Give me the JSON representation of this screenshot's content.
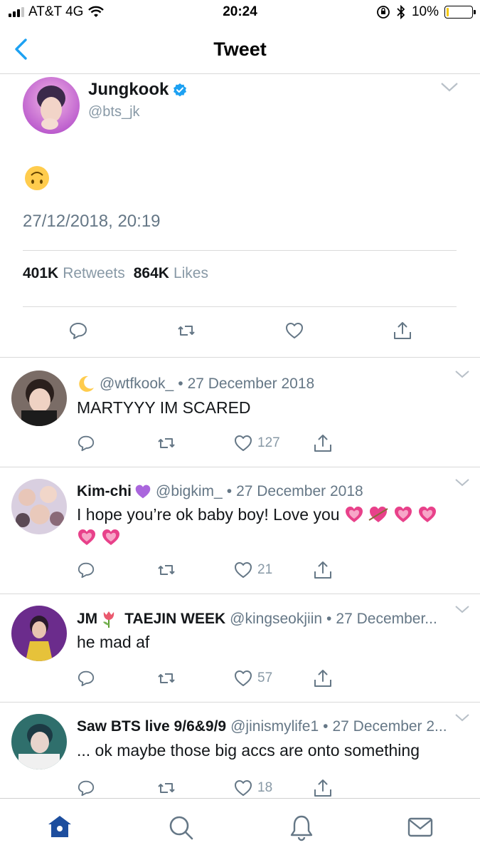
{
  "status_bar": {
    "carrier": "AT&T 4G",
    "time": "20:24",
    "battery": "10%",
    "battery_level": 0.1,
    "icons": [
      "signal-icon",
      "wifi-icon",
      "orientation-lock-icon",
      "bluetooth-icon",
      "battery-icon"
    ]
  },
  "nav": {
    "title": "Tweet",
    "back_icon": "chevron-left-icon"
  },
  "tweet": {
    "name": "Jungkook",
    "handle": "@bts_jk",
    "verified": true,
    "content_emoji": "upside-down-face",
    "date": "27/12/2018, 20:19",
    "retweets_count": "401K",
    "retweets_label": "Retweets",
    "likes_count": "864K",
    "likes_label": "Likes",
    "actions": [
      "reply-icon",
      "retweet-icon",
      "like-icon",
      "share-icon"
    ]
  },
  "replies": [
    {
      "name_emoji": "crescent-moon",
      "name": "",
      "handle": "@wtfkook_",
      "dot": "•",
      "date": "27 December 2018",
      "text": "MARTYYY IM SCARED",
      "likes": "127"
    },
    {
      "name": "Kim-chi",
      "name_emoji": "purple-heart",
      "handle": "@bigkim_",
      "dot": "•",
      "date": "27 December 2018",
      "text": "I hope you’re ok baby boy! Love you",
      "text_emojis": [
        "growing-heart",
        "heart-with-arrow",
        "growing-heart",
        "growing-heart",
        "growing-heart",
        "growing-heart"
      ],
      "likes": "21"
    },
    {
      "name": "JM",
      "name_emoji": "tulip",
      "name_suffix": "TAEJIN WEEK",
      "handle": "@kingseokjiin",
      "dot": "•",
      "date": "27 December...",
      "text": "he mad af",
      "likes": "57"
    },
    {
      "name": "Saw BTS live 9/6&9/9",
      "handle": "@jinismylife1",
      "dot": "•",
      "date": "27 December 2...",
      "text": "... ok maybe those big accs are onto something",
      "likes": "18"
    }
  ],
  "tab_bar": {
    "tabs": [
      "home-icon",
      "search-icon",
      "notifications-icon",
      "messages-icon"
    ],
    "active": "home-icon"
  },
  "colors": {
    "accent": "#1da1f2",
    "text": "#14171a",
    "muted": "#657786",
    "icon_gray": "#657786",
    "heart_pink": "#e8418a"
  }
}
